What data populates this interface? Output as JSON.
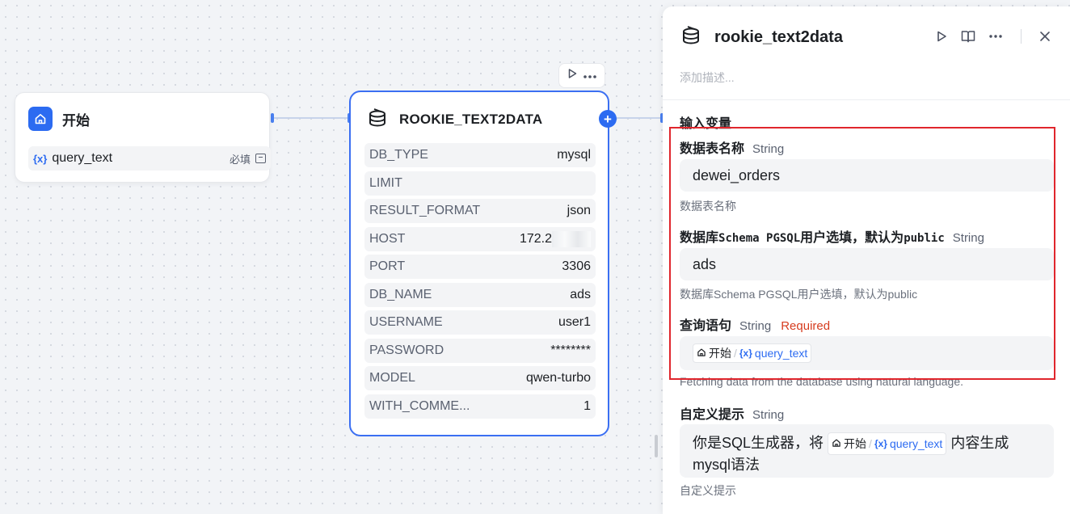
{
  "start_node": {
    "title": "开始",
    "variable": {
      "tag": "{x}",
      "name": "query_text",
      "required_label": "必填"
    }
  },
  "rookie_node": {
    "title": "ROOKIE_TEXT2DATA",
    "params": [
      {
        "key": "DB_TYPE",
        "value": "mysql"
      },
      {
        "key": "LIMIT",
        "value": ""
      },
      {
        "key": "RESULT_FORMAT",
        "value": "json"
      },
      {
        "key": "HOST",
        "value": "172.2"
      },
      {
        "key": "PORT",
        "value": "3306"
      },
      {
        "key": "DB_NAME",
        "value": "ads"
      },
      {
        "key": "USERNAME",
        "value": "user1"
      },
      {
        "key": "PASSWORD",
        "value": "********"
      },
      {
        "key": "MODEL",
        "value": "qwen-turbo"
      },
      {
        "key": "WITH_COMME...",
        "value": "1"
      }
    ],
    "add_label": "+"
  },
  "panel": {
    "title": "rookie_text2data",
    "description_placeholder": "添加描述...",
    "section_title": "输入变量",
    "fields": [
      {
        "label": "数据表名称",
        "type": "String",
        "value": "dewei_orders",
        "hint": "数据表名称"
      },
      {
        "label_prefix": "数据库",
        "label_mono1": "Schema PGSQL",
        "label_mid": "用户选填，默认为",
        "label_mono2": "public",
        "type": "String",
        "value": "ads",
        "hint": "数据库Schema PGSQL用户选填，默认为public"
      },
      {
        "label": "查询语句",
        "type": "String",
        "required": "Required",
        "ref_node": "开始",
        "ref_tag": "{x}",
        "ref_var": "query_text",
        "hint": "Fetching data from the database using natural language."
      },
      {
        "label": "自定义提示",
        "type": "String",
        "text_before": "你是SQL生成器，将",
        "ref_node": "开始",
        "ref_tag": "{x}",
        "ref_var": "query_text",
        "text_after": "内容生成",
        "text_line2": "mysql语法",
        "hint": "自定义提示"
      }
    ]
  },
  "colors": {
    "accent": "#2c6bf1",
    "highlight": "#e0262d",
    "required": "#d63c1f"
  },
  "icons": [
    "home-icon",
    "rookie-logo-icon",
    "play-icon",
    "more-icon",
    "book-icon",
    "close-icon",
    "edit-icon"
  ]
}
